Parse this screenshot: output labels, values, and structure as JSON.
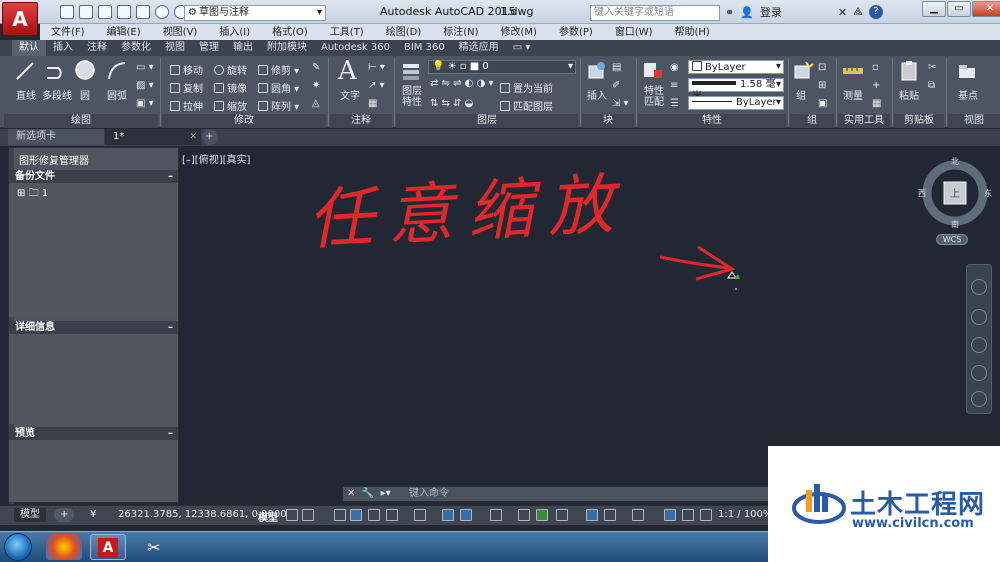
{
  "window": {
    "app_title": "Autodesk AutoCAD 2015",
    "file_name": "1.dwg",
    "app_logo": "A",
    "search_placeholder": "键入关键字或短语",
    "sign_in": "登录",
    "help": "?"
  },
  "workspace": {
    "value": "草图与注释"
  },
  "menu": [
    "文件(F)",
    "编辑(E)",
    "视图(V)",
    "插入(I)",
    "格式(O)",
    "工具(T)",
    "绘图(D)",
    "标注(N)",
    "修改(M)",
    "参数(P)",
    "窗口(W)",
    "帮助(H)"
  ],
  "ribbon_tabs": [
    "默认",
    "插入",
    "注释",
    "参数化",
    "视图",
    "管理",
    "输出",
    "附加模块",
    "Autodesk 360",
    "BIM 360",
    "精选应用",
    "▭ ▾"
  ],
  "ribbon": {
    "draw": {
      "title": "绘图",
      "line": "直线",
      "polyline": "多段线",
      "circle": "圆",
      "arc": "圆弧"
    },
    "modify": {
      "title": "修改",
      "move": "移动",
      "rotate": "旋转",
      "trim": "修剪",
      "copy": "复制",
      "mirror": "镜像",
      "fillet": "圆角",
      "stretch": "拉伸",
      "scale": "缩放",
      "array": "阵列"
    },
    "annotation": {
      "title": "注释",
      "text": "文字"
    },
    "layers": {
      "title": "图层",
      "layer_props": "图层\n特性",
      "layer_value": "0",
      "set_current": "置为当前",
      "match_layer": "匹配图层"
    },
    "block": {
      "title": "块",
      "insert": "插入"
    },
    "properties": {
      "title": "特性",
      "match": "特性\n匹配",
      "color": "ByLayer",
      "lineweight": "1.58 毫米",
      "linetype": "ByLayer"
    },
    "groups": {
      "title": "组",
      "group": "组"
    },
    "utilities": {
      "title": "实用工具",
      "measure": "测量"
    },
    "clipboard": {
      "title": "剪贴板",
      "paste": "粘贴"
    },
    "view": {
      "title": "视图",
      "base": "基点"
    }
  },
  "file_tabs": [
    {
      "label": "新选项卡"
    },
    {
      "label": "1*"
    }
  ],
  "palette": {
    "title": "图形修复管理器",
    "backup_header": "备份文件",
    "backup_item": "1",
    "details_header": "详细信息",
    "preview_header": "预览",
    "collapse": "–"
  },
  "viewport_label": "[–][俯视][真实]",
  "annotation_text": "任意缩放",
  "viewcube": {
    "north": "北",
    "south": "南",
    "east": "东",
    "west": "西",
    "face": "上",
    "wcs": "WCS"
  },
  "command": {
    "placeholder": "键入命令"
  },
  "model_tabs": {
    "model": "模型",
    "add": "+"
  },
  "status": {
    "coords": "26321.3785, 12338.6861, 0.0000",
    "model": "模型",
    "scale": "1:1 / 100%"
  },
  "watermark": {
    "title": "土木工程网",
    "url": "www.civilcn.com"
  }
}
